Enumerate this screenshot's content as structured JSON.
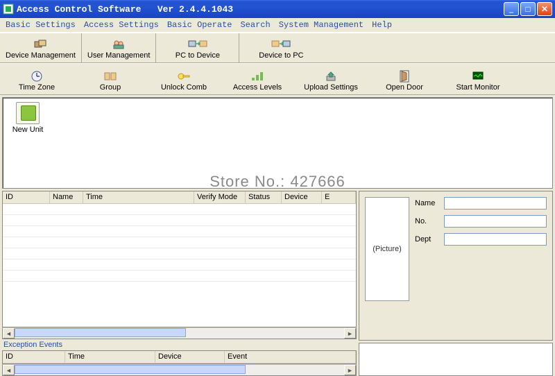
{
  "window": {
    "title": "Access Control Software   Ver 2.4.4.1043"
  },
  "menu": {
    "items": [
      "Basic Settings",
      "Access Settings",
      "Basic Operate",
      "Search",
      "System Management",
      "Help"
    ]
  },
  "toolbar1": {
    "device_mgmt": "Device Management",
    "user_mgmt": "User Management",
    "pc_to_device": "PC to Device",
    "device_to_pc": "Device to PC"
  },
  "toolbar2": {
    "time_zone": "Time Zone",
    "group": "Group",
    "unlock_comb": "Unlock Comb",
    "access_levels": "Access Levels",
    "upload_settings": "Upload Settings",
    "open_door": "Open Door",
    "start_monitor": "Start Monitor"
  },
  "desktop": {
    "new_unit": "New Unit"
  },
  "watermark": "Store No.: 427666",
  "events_grid": {
    "columns": [
      "ID",
      "Name",
      "Time",
      "Verify Mode",
      "Status",
      "Device",
      "E"
    ]
  },
  "exception": {
    "title": "Exception Events",
    "columns": [
      "ID",
      "Time",
      "Device",
      "Event"
    ]
  },
  "details": {
    "picture_placeholder": "(Picture)",
    "name_label": "Name",
    "no_label": "No.",
    "dept_label": "Dept",
    "name_value": "",
    "no_value": "",
    "dept_value": ""
  }
}
